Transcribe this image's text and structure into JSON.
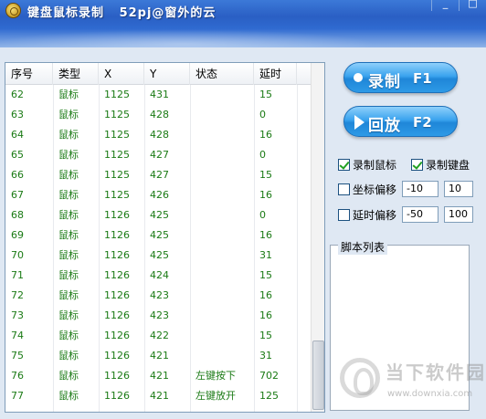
{
  "window": {
    "title": "键盘鼠标录制   52pj@窗外的云",
    "minimize": "_",
    "maximize": "□"
  },
  "list": {
    "headers": [
      "序号",
      "类型",
      "X",
      "Y",
      "状态",
      "延时"
    ],
    "rows": [
      [
        "62",
        "鼠标",
        "1125",
        "431",
        "",
        "15"
      ],
      [
        "63",
        "鼠标",
        "1125",
        "428",
        "",
        "0"
      ],
      [
        "64",
        "鼠标",
        "1125",
        "428",
        "",
        "16"
      ],
      [
        "65",
        "鼠标",
        "1125",
        "427",
        "",
        "0"
      ],
      [
        "66",
        "鼠标",
        "1125",
        "427",
        "",
        "15"
      ],
      [
        "67",
        "鼠标",
        "1125",
        "426",
        "",
        "16"
      ],
      [
        "68",
        "鼠标",
        "1126",
        "425",
        "",
        "0"
      ],
      [
        "69",
        "鼠标",
        "1126",
        "425",
        "",
        "16"
      ],
      [
        "70",
        "鼠标",
        "1126",
        "425",
        "",
        "31"
      ],
      [
        "71",
        "鼠标",
        "1126",
        "424",
        "",
        "15"
      ],
      [
        "72",
        "鼠标",
        "1126",
        "423",
        "",
        "16"
      ],
      [
        "73",
        "鼠标",
        "1126",
        "423",
        "",
        "16"
      ],
      [
        "74",
        "鼠标",
        "1126",
        "422",
        "",
        "15"
      ],
      [
        "75",
        "鼠标",
        "1126",
        "421",
        "",
        "31"
      ],
      [
        "76",
        "鼠标",
        "1126",
        "421",
        "左键按下",
        "702"
      ],
      [
        "77",
        "鼠标",
        "1126",
        "421",
        "左键放开",
        "125"
      ]
    ]
  },
  "controls": {
    "record": {
      "label": "录制",
      "key": "F1"
    },
    "replay": {
      "label": "回放",
      "key": "F2"
    },
    "record_mouse": "录制鼠标",
    "record_keyboard": "录制键盘",
    "coord_offset": {
      "label": "坐标偏移",
      "x": "-10",
      "y": "10"
    },
    "delay_offset": {
      "label": "延时偏移",
      "min": "-50",
      "max": "100"
    },
    "script_list_title": "脚本列表"
  },
  "watermark": {
    "text": "当下软件园",
    "url": "www.downxia.com"
  },
  "colors": {
    "row_text": "#1a7a14",
    "button_blue": "#2d9ae6",
    "titlebar": "#2a5fc4"
  }
}
